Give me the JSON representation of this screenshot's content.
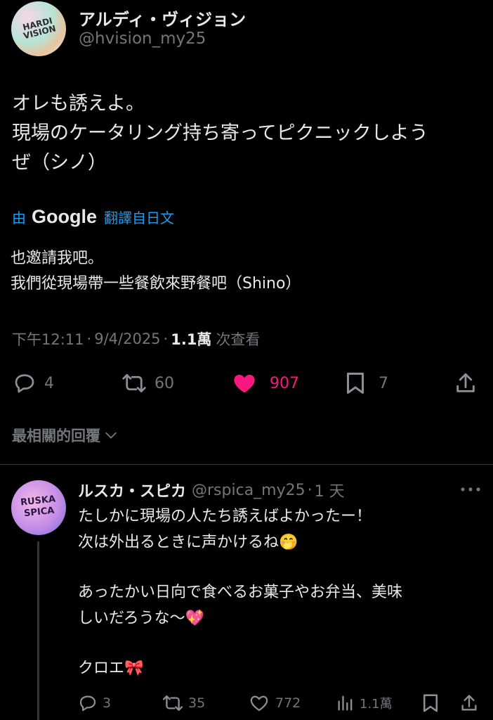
{
  "tweet": {
    "author_name": "アルディ・ヴィジョン",
    "handle": "@hvision_my25",
    "avatar_text": "HARDI VISION",
    "text_lines": [
      "オレも誘えよ。",
      "現場のケータリング持ち寄ってピクニックしよう",
      "ぜ（シノ）"
    ],
    "translate_by": "由",
    "translate_brand": "Google",
    "translate_label": "翻譯自日文",
    "translation_lines": [
      "也邀請我吧。",
      "我們從現場帶一些餐飲來野餐吧（Shino）"
    ],
    "time": "下午12:11",
    "date": "9/4/2025",
    "views_count": "1.1萬",
    "views_label": "次查看",
    "replies": "4",
    "retweets": "60",
    "likes": "907",
    "bookmarks": "7"
  },
  "sort_label": "最相關的回覆",
  "reply": {
    "author_name": "ルスカ・スピカ",
    "handle": "@rspica_my25",
    "age": "1 天",
    "avatar_text": "RUSKA SPICA",
    "line1": "たしかに現場の人たち誘えばよかったー！",
    "line2": "次は外出るときに声かけるね🤭",
    "line3": "あったかい日向で食べるお菓子やお弁当、美味",
    "line4": "しいだろうな～💖",
    "line5": "クロエ🎀",
    "replies": "3",
    "retweets": "35",
    "likes": "772",
    "views": "1.1萬"
  },
  "colors": {
    "accent": "#1d9bf0",
    "like": "#f91880",
    "muted": "#71767b",
    "text": "#e7e9ea"
  }
}
